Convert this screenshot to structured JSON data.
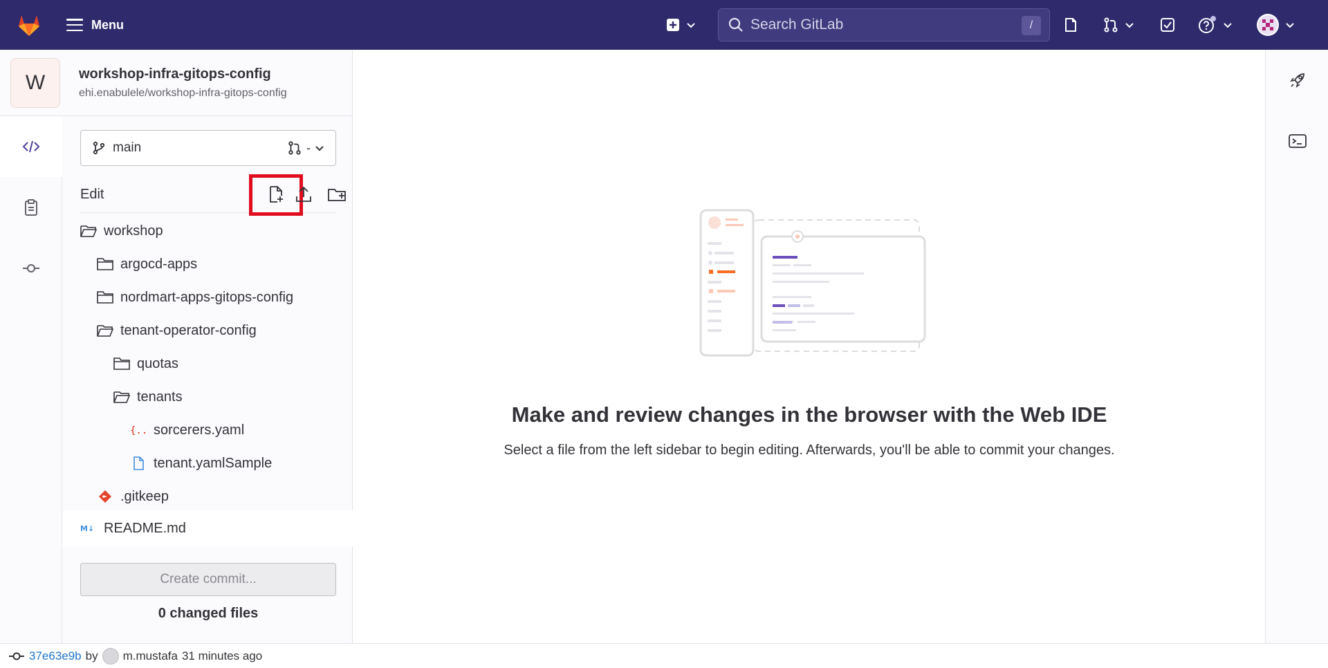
{
  "navbar": {
    "menu_label": "Menu",
    "search_placeholder": "Search GitLab",
    "search_shortcut": "/"
  },
  "project": {
    "avatar_letter": "W",
    "name": "workshop-infra-gitops-config",
    "path": "ehi.enabulele/workshop-infra-gitops-config"
  },
  "branch": {
    "name": "main",
    "mr_value": "-"
  },
  "edit": {
    "label": "Edit"
  },
  "tree": [
    {
      "label": "workshop",
      "type": "folder-open",
      "depth": 0
    },
    {
      "label": "argocd-apps",
      "type": "folder",
      "depth": 1
    },
    {
      "label": "nordmart-apps-gitops-config",
      "type": "folder",
      "depth": 1
    },
    {
      "label": "tenant-operator-config",
      "type": "folder-open",
      "depth": 1
    },
    {
      "label": "quotas",
      "type": "folder",
      "depth": 2
    },
    {
      "label": "tenants",
      "type": "folder-open",
      "depth": 2
    },
    {
      "label": "sorcerers.yaml",
      "type": "yaml",
      "depth": 3
    },
    {
      "label": "tenant.yamlSample",
      "type": "file",
      "depth": 3
    },
    {
      "label": ".gitkeep",
      "type": "git",
      "depth": 1
    },
    {
      "label": "README.md",
      "type": "markdown",
      "depth": 0
    }
  ],
  "commit": {
    "button_label": "Create commit...",
    "changed_files": "0 changed files"
  },
  "empty_state": {
    "title": "Make and review changes in the browser with the Web IDE",
    "subtitle": "Select a file from the left sidebar to begin editing. Afterwards, you'll be able to commit your changes."
  },
  "status_bar": {
    "commit_sha": "37e63e9b",
    "by": "by",
    "author": "m.mustafa",
    "time": "31 minutes ago"
  },
  "colors": {
    "navbar": "#2f2a6b",
    "highlight": "#e10d1f",
    "accent": "#6b4fbb"
  }
}
